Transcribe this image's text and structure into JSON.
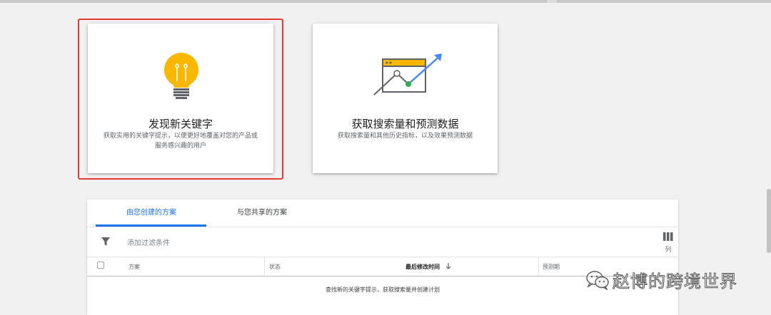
{
  "cards": [
    {
      "title": "发现新关键字",
      "desc_line1": "获取实用的关键字提示，以便更好地覆盖对您的产品或",
      "desc_line2": "服务感兴趣的用户",
      "icon": "lightbulb-icon",
      "highlighted": true
    },
    {
      "title": "获取搜索量和预测数据",
      "desc_line1": "获取搜索量和其他历史指标，以及效果预测数据",
      "icon": "trend-chart-icon"
    }
  ],
  "plans": {
    "tabs": [
      {
        "label": "由您创建的方案",
        "active": true
      },
      {
        "label": "与您共享的方案",
        "active": false
      }
    ],
    "filter_placeholder": "添加过滤条件",
    "columns_button_label": "列",
    "table_headers": [
      "方案",
      "状态",
      "最后修改时间",
      "预测期"
    ],
    "sorted_column": "最后修改时间",
    "sort_direction": "descending",
    "empty_message": "查找新的关键字提示，获取搜索量并创建计划"
  },
  "watermark": {
    "text": "赵博的跨境世界",
    "icon": "wechat-icon"
  },
  "colors": {
    "accent": "#1a73e8",
    "highlight_border": "#e53935",
    "bulb": "#f9b700",
    "trend_arrow": "#4a8af4",
    "trend_point": "#34a853"
  }
}
